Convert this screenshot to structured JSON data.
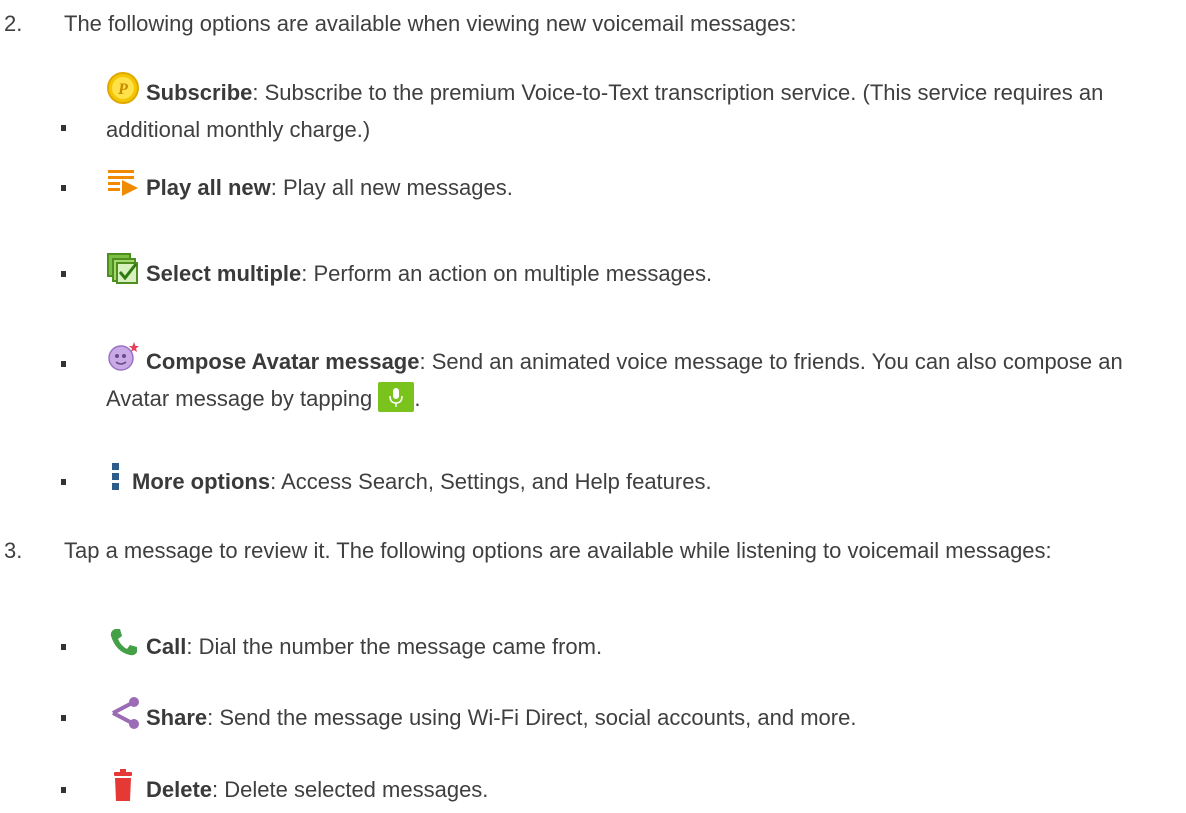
{
  "steps": [
    {
      "number": "2.",
      "text": "The following options are available when viewing new voicemail messages:"
    },
    {
      "number": "3.",
      "text": "Tap a message to review it. The following options are available while listening to voicemail messages:"
    }
  ],
  "step2_options": [
    {
      "icon": "subscribe-icon",
      "label": "Subscribe",
      "desc": ": Subscribe to the premium Voice-to-Text transcription service. (This service requires an additional monthly charge.)"
    },
    {
      "icon": "play-all-new-icon",
      "label": "Play all new",
      "desc": ": Play all new messages."
    },
    {
      "icon": "select-multiple-icon",
      "label": "Select multiple",
      "desc": ": Perform an action on multiple messages."
    },
    {
      "icon": "compose-avatar-icon",
      "label": "Compose Avatar message",
      "desc": ": Send an animated voice message to friends. You can also compose an Avatar message by tapping ",
      "trailing_icon": "mic-button-icon",
      "trailing_text": "."
    },
    {
      "icon": "more-options-icon",
      "label": "More options",
      "desc": ": Access Search, Settings, and Help features."
    }
  ],
  "step3_options": [
    {
      "icon": "call-icon",
      "label": "Call",
      "desc": ": Dial the number the message came from."
    },
    {
      "icon": "share-icon",
      "label": "Share",
      "desc": ": Send the message using Wi-Fi Direct, social accounts, and more."
    },
    {
      "icon": "delete-icon",
      "label": "Delete",
      "desc": ": Delete selected messages."
    }
  ],
  "colors": {
    "text": "#3f3f3f",
    "mic_green": "#7ac21c",
    "call_green": "#43a047",
    "share_purple": "#9b6bb5",
    "delete_red": "#e53935"
  }
}
